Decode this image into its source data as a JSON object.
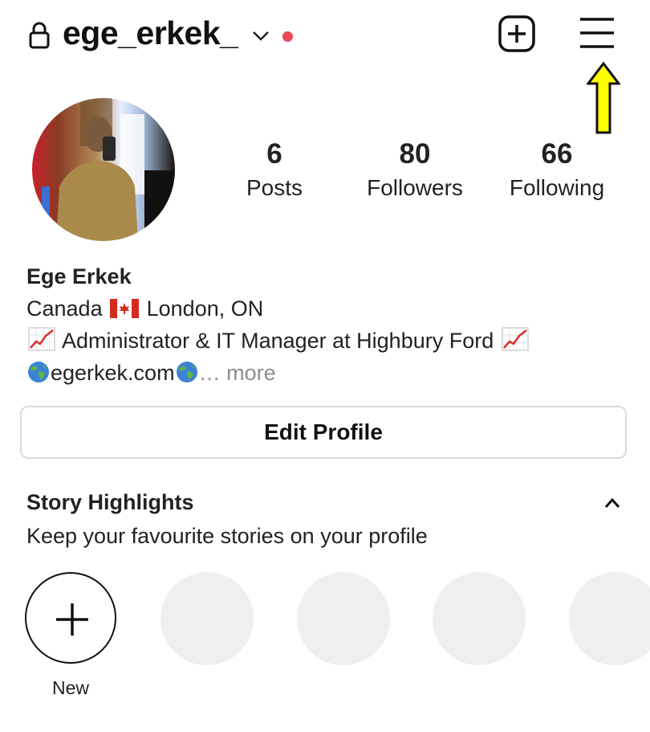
{
  "header": {
    "username": "ege_erkek_",
    "icons": [
      "lock-icon",
      "chevron-down-icon",
      "notification-dot",
      "new-post-icon",
      "menu-icon",
      "highlight-arrow"
    ],
    "dot_color": "#ed4956"
  },
  "profile": {
    "stats": [
      {
        "value": "6",
        "label": "Posts"
      },
      {
        "value": "80",
        "label": "Followers"
      },
      {
        "value": "66",
        "label": "Following"
      }
    ],
    "name": "Ege Erkek",
    "location_prefix": "Canada",
    "location_suffix": "London, ON",
    "bio_line": "Administrator & IT Manager at Highbury Ford",
    "website": "egerkek.com",
    "ellipsis": "…",
    "more": "more"
  },
  "actions": {
    "edit_profile": "Edit Profile"
  },
  "highlights": {
    "title": "Story Highlights",
    "subtitle": "Keep your favourite stories on your profile",
    "new_label": "New"
  }
}
